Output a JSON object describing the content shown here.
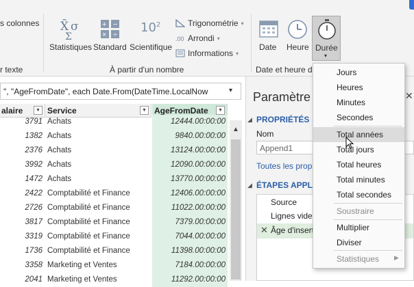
{
  "ribbon": {
    "partial_label": "s colonnes",
    "partial_group_label": "r texte",
    "statistiques": "Statistiques",
    "standard": "Standard",
    "scientifique": "Scientifique",
    "trigonometrie": "Trigonométrie",
    "arrondi": "Arrondi",
    "informations": "Informations",
    "from_number_group": "À partir d'un nombre",
    "date": "Date",
    "heure": "Heure",
    "duree": "Durée",
    "date_group": "Date et heure d",
    "sci_glyph": "10"
  },
  "formula": {
    "text": "\", \"AgeFromDate\", each Date.From(DateTime.LocalNow"
  },
  "grid": {
    "headers": {
      "salary": "alaire",
      "service": "Service",
      "age": "AgeFromDate"
    },
    "rows": [
      {
        "salary": "3791",
        "service": "Achats",
        "age": "12444.00:00:00"
      },
      {
        "salary": "1382",
        "service": "Achats",
        "age": "9840.00:00:00"
      },
      {
        "salary": "2376",
        "service": "Achats",
        "age": "13124.00:00:00"
      },
      {
        "salary": "3992",
        "service": "Achats",
        "age": "12090.00:00:00"
      },
      {
        "salary": "1472",
        "service": "Achats",
        "age": "13770.00:00:00"
      },
      {
        "salary": "2422",
        "service": "Comptabilité et Finance",
        "age": "12406.00:00:00"
      },
      {
        "salary": "2726",
        "service": "Comptabilité et Finance",
        "age": "11022.00:00:00"
      },
      {
        "salary": "3817",
        "service": "Comptabilité et Finance",
        "age": "7379.00:00:00"
      },
      {
        "salary": "3319",
        "service": "Comptabilité et Finance",
        "age": "7044.00:00:00"
      },
      {
        "salary": "1736",
        "service": "Comptabilité et Finance",
        "age": "11398.00:00:00"
      },
      {
        "salary": "3358",
        "service": "Marketing et Ventes",
        "age": "7184.00:00:00"
      },
      {
        "salary": "2041",
        "service": "Marketing et Ventes",
        "age": "11292.00:00:00"
      }
    ]
  },
  "pane": {
    "title": "Paramètre",
    "properties": "PROPRIÉTÉS",
    "name_label": "Nom",
    "name_value": "Append1",
    "all_props": "Toutes les prop",
    "steps_title": "ÉTAPES APPLIC",
    "steps": [
      "Source",
      "Lignes vides",
      "Âge d'insert"
    ]
  },
  "menu": {
    "items": [
      "Jours",
      "Heures",
      "Minutes",
      "Secondes",
      "Total années",
      "Total jours",
      "Total heures",
      "Total minutes",
      "Total secondes",
      "Soustraire",
      "Multiplier",
      "Diviser",
      "Statistiques"
    ]
  }
}
